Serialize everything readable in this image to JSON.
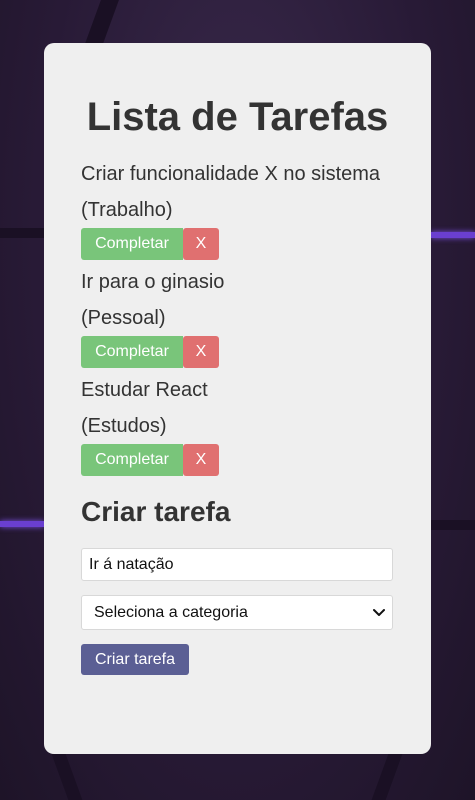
{
  "app": {
    "title": "Lista de Tarefas"
  },
  "tasks": [
    {
      "name": "Criar funcionalidade X no sistema",
      "category": "(Trabalho)",
      "complete_label": "Completar",
      "remove_label": "X"
    },
    {
      "name": "Ir para o ginasio",
      "category": "(Pessoal)",
      "complete_label": "Completar",
      "remove_label": "X"
    },
    {
      "name": "Estudar React",
      "category": "(Estudos)",
      "complete_label": "Completar",
      "remove_label": "X"
    }
  ],
  "form": {
    "title": "Criar tarefa",
    "task_input_value": "Ir á natação",
    "category_select_value": "Seleciona a categoria",
    "submit_label": "Criar tarefa"
  },
  "colors": {
    "complete": "#79c57a",
    "remove": "#e07070",
    "submit": "#5b5f94",
    "card": "#efefef"
  }
}
